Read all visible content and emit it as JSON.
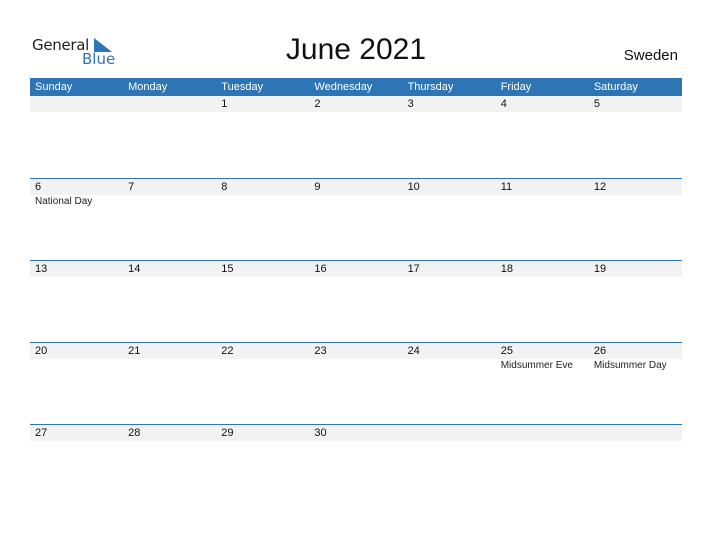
{
  "logo": {
    "general": "General",
    "blue": "Blue"
  },
  "title": "June 2021",
  "country": "Sweden",
  "days": [
    "Sunday",
    "Monday",
    "Tuesday",
    "Wednesday",
    "Thursday",
    "Friday",
    "Saturday"
  ],
  "weeks": [
    {
      "nums": [
        "",
        "",
        "1",
        "2",
        "3",
        "4",
        "5"
      ],
      "events": [
        "",
        "",
        "",
        "",
        "",
        "",
        ""
      ]
    },
    {
      "nums": [
        "6",
        "7",
        "8",
        "9",
        "10",
        "11",
        "12"
      ],
      "events": [
        "National Day",
        "",
        "",
        "",
        "",
        "",
        ""
      ]
    },
    {
      "nums": [
        "13",
        "14",
        "15",
        "16",
        "17",
        "18",
        "19"
      ],
      "events": [
        "",
        "",
        "",
        "",
        "",
        "",
        ""
      ]
    },
    {
      "nums": [
        "20",
        "21",
        "22",
        "23",
        "24",
        "25",
        "26"
      ],
      "events": [
        "",
        "",
        "",
        "",
        "",
        "Midsummer Eve",
        "Midsummer Day"
      ]
    },
    {
      "nums": [
        "27",
        "28",
        "29",
        "30",
        "",
        "",
        ""
      ],
      "events": [
        "",
        "",
        "",
        "",
        "",
        "",
        ""
      ]
    }
  ]
}
